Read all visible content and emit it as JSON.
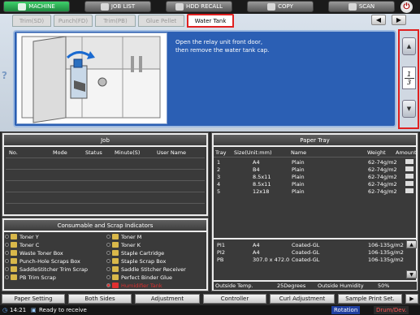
{
  "nav": {
    "machine": "MACHINE",
    "job_list": "JOB LIST",
    "hdd_recall": "HDD RECALL",
    "copy": "COPY",
    "scan": "SCAN"
  },
  "tabs": [
    "Trim(SD)",
    "Punch(FD)",
    "Trim(PB)",
    "Glue Pellet",
    "Water Tank"
  ],
  "guide": {
    "instruction_line1": "Open the relay unit front door,",
    "instruction_line2": "then remove the water tank cap.",
    "page_current": "1",
    "page_total": "3"
  },
  "job": {
    "title": "Job",
    "columns": [
      "No.",
      "Mode",
      "Status",
      "Minute(S)",
      "User Name"
    ]
  },
  "consumables": {
    "title": "Consumable and Scrap Indicators",
    "left": [
      "Toner Y",
      "Toner C",
      "Waste Toner Box",
      "Punch-Hole Scraps Box",
      "SaddleStitcher Trim Scrap",
      "PB Trim Scrap"
    ],
    "right": [
      "Toner M",
      "Toner K",
      "Staple Cartridge",
      "Staple Scrap Box",
      "Saddle Stitcher Receiver",
      "Perfect Binder Glue",
      "Humidifier Tank"
    ],
    "alert_color": "#e03030"
  },
  "tray": {
    "title": "Paper Tray",
    "columns": [
      "Tray",
      "Size(Unit:mm)",
      "Name",
      "Weight",
      "Amount"
    ],
    "rows": [
      {
        "tray": "1",
        "size": "A4",
        "name": "Plain",
        "weight": "62-74g/m2"
      },
      {
        "tray": "2",
        "size": "B4",
        "name": "Plain",
        "weight": "62-74g/m2"
      },
      {
        "tray": "3",
        "size": "8.5x11",
        "name": "Plain",
        "weight": "62-74g/m2"
      },
      {
        "tray": "4",
        "size": "8.5x11",
        "name": "Plain",
        "weight": "62-74g/m2"
      },
      {
        "tray": "5",
        "size": "12x18",
        "name": "Plain",
        "weight": "62-74g/m2"
      }
    ],
    "pi_rows": [
      {
        "tray": "PI1",
        "size": "A4",
        "name": "Coated-GL",
        "weight": "106-135g/m2"
      },
      {
        "tray": "PI2",
        "size": "A4",
        "name": "Coated-GL",
        "weight": "106-135g/m2"
      },
      {
        "tray": "PB",
        "size": "307.0 x 472.0",
        "name": "Coated-GL",
        "weight": "106-135g/m2"
      }
    ],
    "outside_temp_label": "Outside Temp.",
    "outside_temp_value": "25Degrees",
    "outside_humidity_label": "Outside Humidity",
    "outside_humidity_value": "50%"
  },
  "bottom": [
    "Paper Setting",
    "Both Sides",
    "Adjustment",
    "Controller",
    "Curl Adjustment",
    "Sample Print Set."
  ],
  "status": {
    "time": "14:21",
    "message": "Ready to receive",
    "rotation": "Rotation",
    "drum": "Drum/Dev."
  }
}
